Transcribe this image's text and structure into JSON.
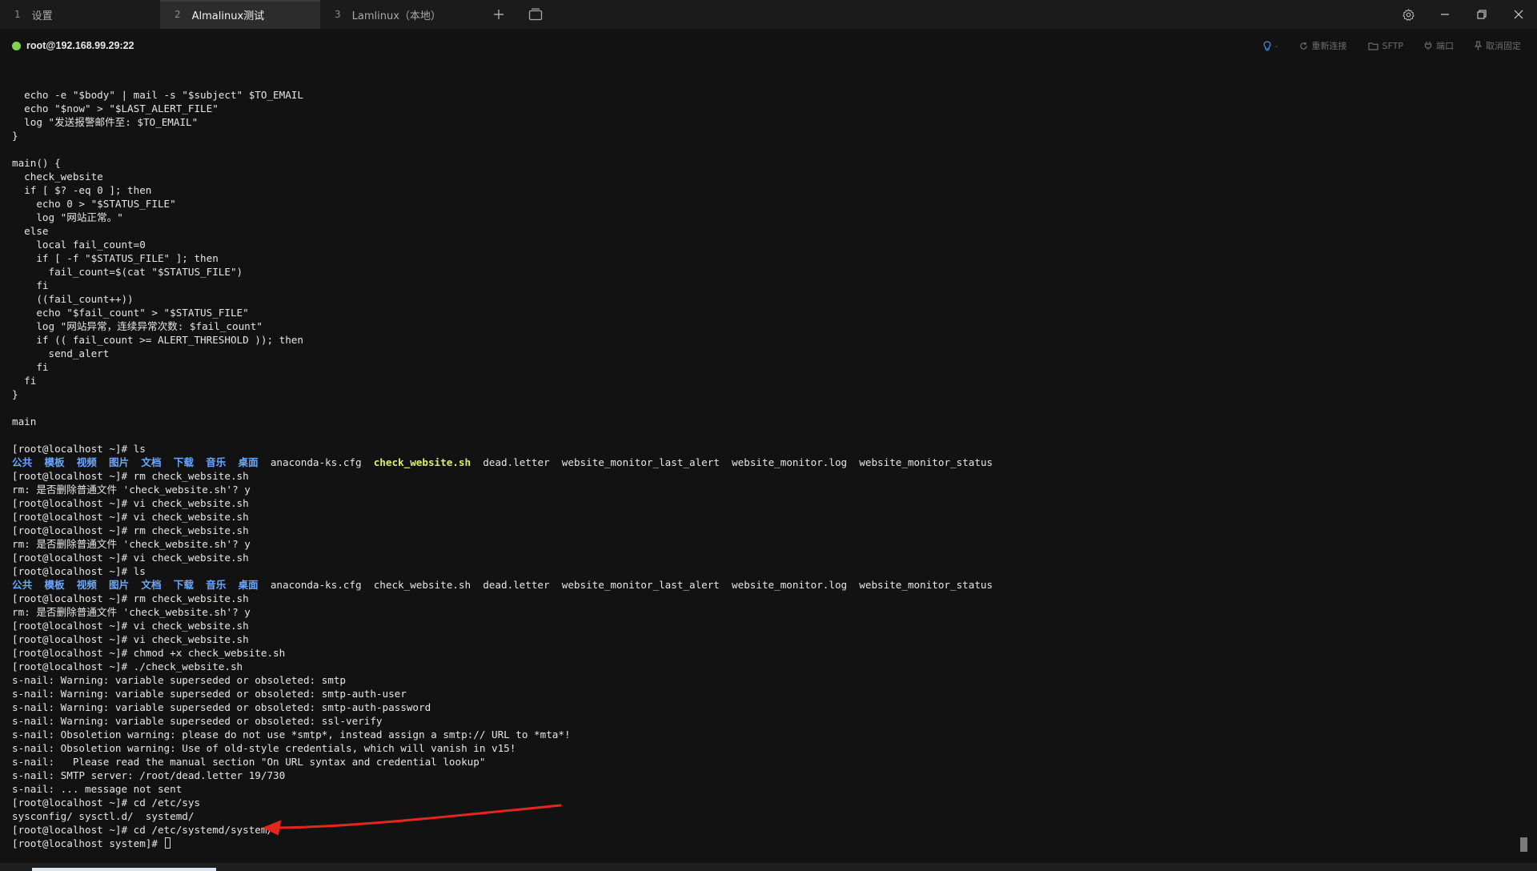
{
  "tabs": [
    {
      "num": "1",
      "label": "设置",
      "active": false
    },
    {
      "num": "2",
      "label": "Almalinux测试",
      "active": true
    },
    {
      "num": "3",
      "label": "Lamlinux（本地）",
      "active": false
    }
  ],
  "session": {
    "host": "root@192.168.99.29:22",
    "status_color": "#7fd34e",
    "tools": {
      "reconnect": "重新连接",
      "sftp": "SFTP",
      "port": "端口",
      "unpin": "取消固定"
    }
  },
  "icons": {
    "new_tab": "plus-icon",
    "window_list": "window-list-icon",
    "settings": "gear-icon",
    "minimize": "minimize-icon",
    "restore": "restore-icon",
    "close": "close-icon",
    "bulb": "bulb-icon",
    "reconnect": "refresh-icon",
    "sftp": "folder-icon",
    "port": "plug-icon",
    "unpin": "pin-icon"
  },
  "colors": {
    "dir_listing": "#6aa7ff",
    "executable": "#d9f06b",
    "annotation_arrow": "#e5261e"
  },
  "terminal": {
    "lines": [
      [
        {
          "t": "  echo -e \"$body\" | mail -s \"$subject\" $TO_EMAIL",
          "c": "plain"
        }
      ],
      [
        {
          "t": "  echo \"$now\" > \"$LAST_ALERT_FILE\"",
          "c": "plain"
        }
      ],
      [
        {
          "t": "  log \"发送报警邮件至: $TO_EMAIL\"",
          "c": "plain"
        }
      ],
      [
        {
          "t": "}",
          "c": "plain"
        }
      ],
      [
        {
          "t": "",
          "c": "plain"
        }
      ],
      [
        {
          "t": "main() {",
          "c": "plain"
        }
      ],
      [
        {
          "t": "  check_website",
          "c": "plain"
        }
      ],
      [
        {
          "t": "  if [ $? -eq 0 ]; then",
          "c": "plain"
        }
      ],
      [
        {
          "t": "    echo 0 > \"$STATUS_FILE\"",
          "c": "plain"
        }
      ],
      [
        {
          "t": "    log \"网站正常。\"",
          "c": "plain"
        }
      ],
      [
        {
          "t": "  else",
          "c": "plain"
        }
      ],
      [
        {
          "t": "    local fail_count=0",
          "c": "plain"
        }
      ],
      [
        {
          "t": "    if [ -f \"$STATUS_FILE\" ]; then",
          "c": "plain"
        }
      ],
      [
        {
          "t": "      fail_count=$(cat \"$STATUS_FILE\")",
          "c": "plain"
        }
      ],
      [
        {
          "t": "    fi",
          "c": "plain"
        }
      ],
      [
        {
          "t": "    ((fail_count++))",
          "c": "plain"
        }
      ],
      [
        {
          "t": "    echo \"$fail_count\" > \"$STATUS_FILE\"",
          "c": "plain"
        }
      ],
      [
        {
          "t": "    log \"网站异常，连续异常次数: $fail_count\"",
          "c": "plain"
        }
      ],
      [
        {
          "t": "    if (( fail_count >= ALERT_THRESHOLD )); then",
          "c": "plain"
        }
      ],
      [
        {
          "t": "      send_alert",
          "c": "plain"
        }
      ],
      [
        {
          "t": "    fi",
          "c": "plain"
        }
      ],
      [
        {
          "t": "  fi",
          "c": "plain"
        }
      ],
      [
        {
          "t": "}",
          "c": "plain"
        }
      ],
      [
        {
          "t": "",
          "c": "plain"
        }
      ],
      [
        {
          "t": "main",
          "c": "plain"
        }
      ],
      [
        {
          "t": "",
          "c": "plain"
        }
      ],
      [
        {
          "t": "[root@localhost ~]# ls",
          "c": "plain"
        }
      ],
      [
        {
          "t": "公共  模板  视频  图片  文档  下载  音乐  桌面",
          "c": "dir"
        },
        {
          "t": "  anaconda-ks.cfg  ",
          "c": "plain"
        },
        {
          "t": "check_website.sh",
          "c": "exec"
        },
        {
          "t": "  dead.letter  website_monitor_last_alert  website_monitor.log  website_monitor_status",
          "c": "plain"
        }
      ],
      [
        {
          "t": "[root@localhost ~]# rm check_website.sh",
          "c": "plain"
        }
      ],
      [
        {
          "t": "rm: 是否删除普通文件 'check_website.sh'? y",
          "c": "plain"
        }
      ],
      [
        {
          "t": "[root@localhost ~]# vi check_website.sh",
          "c": "plain"
        }
      ],
      [
        {
          "t": "[root@localhost ~]# vi check_website.sh",
          "c": "plain"
        }
      ],
      [
        {
          "t": "[root@localhost ~]# rm check_website.sh",
          "c": "plain"
        }
      ],
      [
        {
          "t": "rm: 是否删除普通文件 'check_website.sh'? y",
          "c": "plain"
        }
      ],
      [
        {
          "t": "[root@localhost ~]# vi check_website.sh",
          "c": "plain"
        }
      ],
      [
        {
          "t": "[root@localhost ~]# ls",
          "c": "plain"
        }
      ],
      [
        {
          "t": "公共  模板  视频  图片  文档  下载  音乐  桌面",
          "c": "dir"
        },
        {
          "t": "  anaconda-ks.cfg  check_website.sh  dead.letter  website_monitor_last_alert  website_monitor.log  website_monitor_status",
          "c": "plain"
        }
      ],
      [
        {
          "t": "[root@localhost ~]# rm check_website.sh",
          "c": "plain"
        }
      ],
      [
        {
          "t": "rm: 是否删除普通文件 'check_website.sh'? y",
          "c": "plain"
        }
      ],
      [
        {
          "t": "[root@localhost ~]# vi check_website.sh",
          "c": "plain"
        }
      ],
      [
        {
          "t": "[root@localhost ~]# vi check_website.sh",
          "c": "plain"
        }
      ],
      [
        {
          "t": "[root@localhost ~]# chmod +x check_website.sh",
          "c": "plain"
        }
      ],
      [
        {
          "t": "[root@localhost ~]# ./check_website.sh",
          "c": "plain"
        }
      ],
      [
        {
          "t": "s-nail: Warning: variable superseded or obsoleted: smtp",
          "c": "plain"
        }
      ],
      [
        {
          "t": "s-nail: Warning: variable superseded or obsoleted: smtp-auth-user",
          "c": "plain"
        }
      ],
      [
        {
          "t": "s-nail: Warning: variable superseded or obsoleted: smtp-auth-password",
          "c": "plain"
        }
      ],
      [
        {
          "t": "s-nail: Warning: variable superseded or obsoleted: ssl-verify",
          "c": "plain"
        }
      ],
      [
        {
          "t": "s-nail: Obsoletion warning: please do not use *smtp*, instead assign a smtp:// URL to *mta*!",
          "c": "plain"
        }
      ],
      [
        {
          "t": "s-nail: Obsoletion warning: Use of old-style credentials, which will vanish in v15!",
          "c": "plain"
        }
      ],
      [
        {
          "t": "s-nail:   Please read the manual section \"On URL syntax and credential lookup\"",
          "c": "plain"
        }
      ],
      [
        {
          "t": "s-nail: SMTP server: /root/dead.letter 19/730",
          "c": "plain"
        }
      ],
      [
        {
          "t": "s-nail: ... message not sent",
          "c": "plain"
        }
      ],
      [
        {
          "t": "[root@localhost ~]# cd /etc/sys",
          "c": "plain"
        }
      ],
      [
        {
          "t": "sysconfig/ sysctl.d/  systemd/",
          "c": "plain"
        }
      ],
      [
        {
          "t": "[root@localhost ~]# cd /etc/systemd/system/",
          "c": "plain"
        }
      ],
      [
        {
          "t": "[root@localhost system]# ",
          "c": "plain",
          "cursor": true
        }
      ]
    ]
  }
}
